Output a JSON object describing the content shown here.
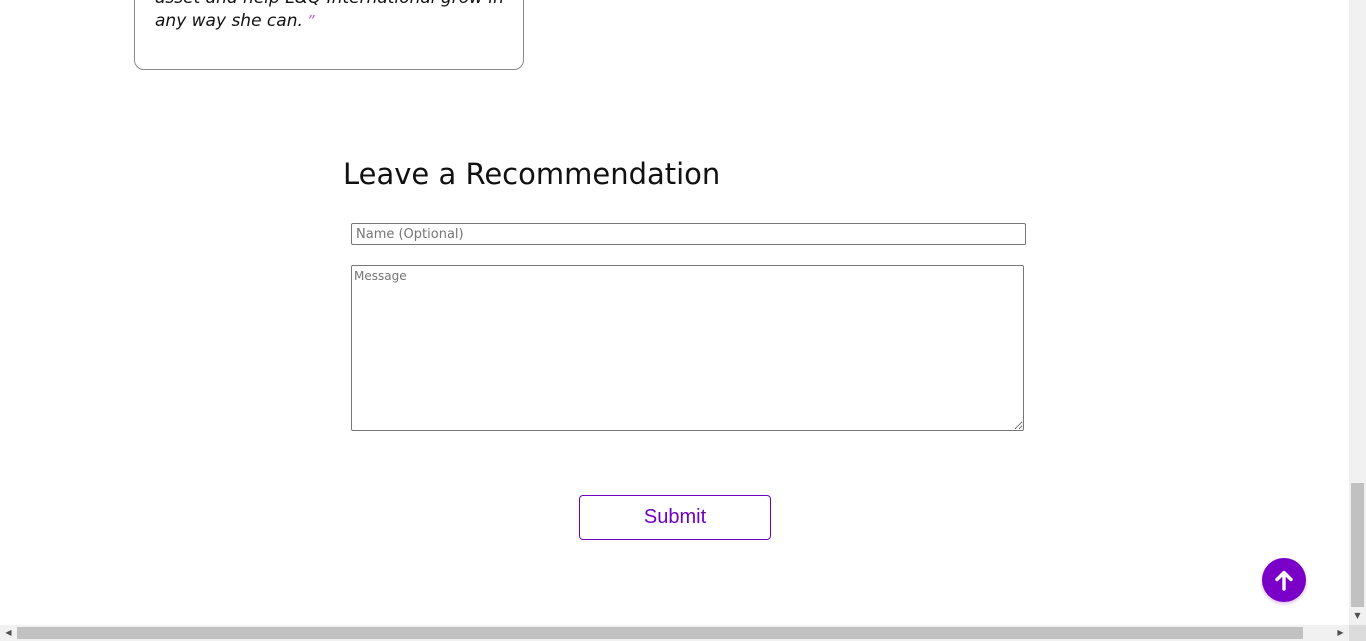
{
  "testimonial": {
    "text_line1": "asset and help L&Q International grow in",
    "text_line2": "any way she can.",
    "close_quote": "”"
  },
  "form": {
    "title": "Leave a Recommendation",
    "name_placeholder": "Name (Optional)",
    "message_placeholder": "Message",
    "submit_label": "Submit"
  },
  "icons": {
    "scroll_top": "arrow-up-icon",
    "scroll_down_arrow": "triangle-down",
    "scroll_left_arrow": "triangle-left",
    "scroll_right_arrow": "triangle-right"
  },
  "scrollbar": {
    "down": "▼",
    "left": "◀",
    "right": "▶"
  },
  "colors": {
    "accent": "#7a00c8",
    "quote_mark": "#c65bd6",
    "submit_text": "#7000c0"
  }
}
